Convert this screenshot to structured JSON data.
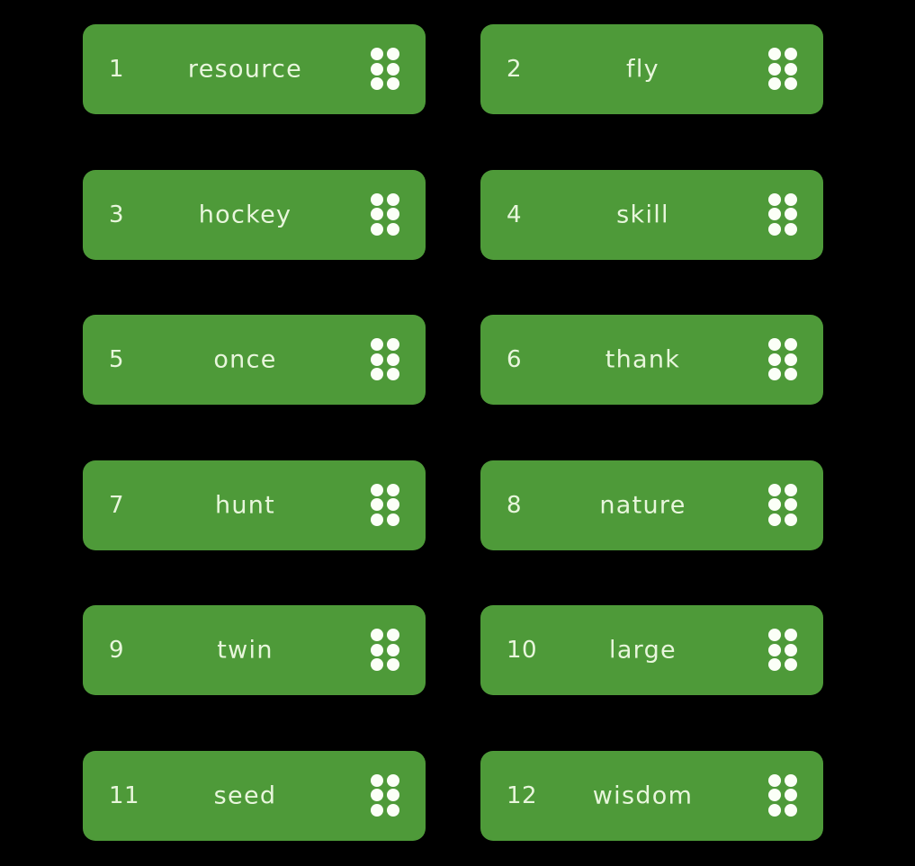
{
  "theme": {
    "background": "#000000",
    "tile_color": "#4e9a39",
    "text_color": "#e8f6dc",
    "handle_color": "#fbfff7"
  },
  "handle_icon": "drag-handle-six-dots",
  "words": [
    {
      "number": "1",
      "word": "resource"
    },
    {
      "number": "2",
      "word": "fly"
    },
    {
      "number": "3",
      "word": "hockey"
    },
    {
      "number": "4",
      "word": "skill"
    },
    {
      "number": "5",
      "word": "once"
    },
    {
      "number": "6",
      "word": "thank"
    },
    {
      "number": "7",
      "word": "hunt"
    },
    {
      "number": "8",
      "word": "nature"
    },
    {
      "number": "9",
      "word": "twin"
    },
    {
      "number": "10",
      "word": "large"
    },
    {
      "number": "11",
      "word": "seed"
    },
    {
      "number": "12",
      "word": "wisdom"
    }
  ]
}
